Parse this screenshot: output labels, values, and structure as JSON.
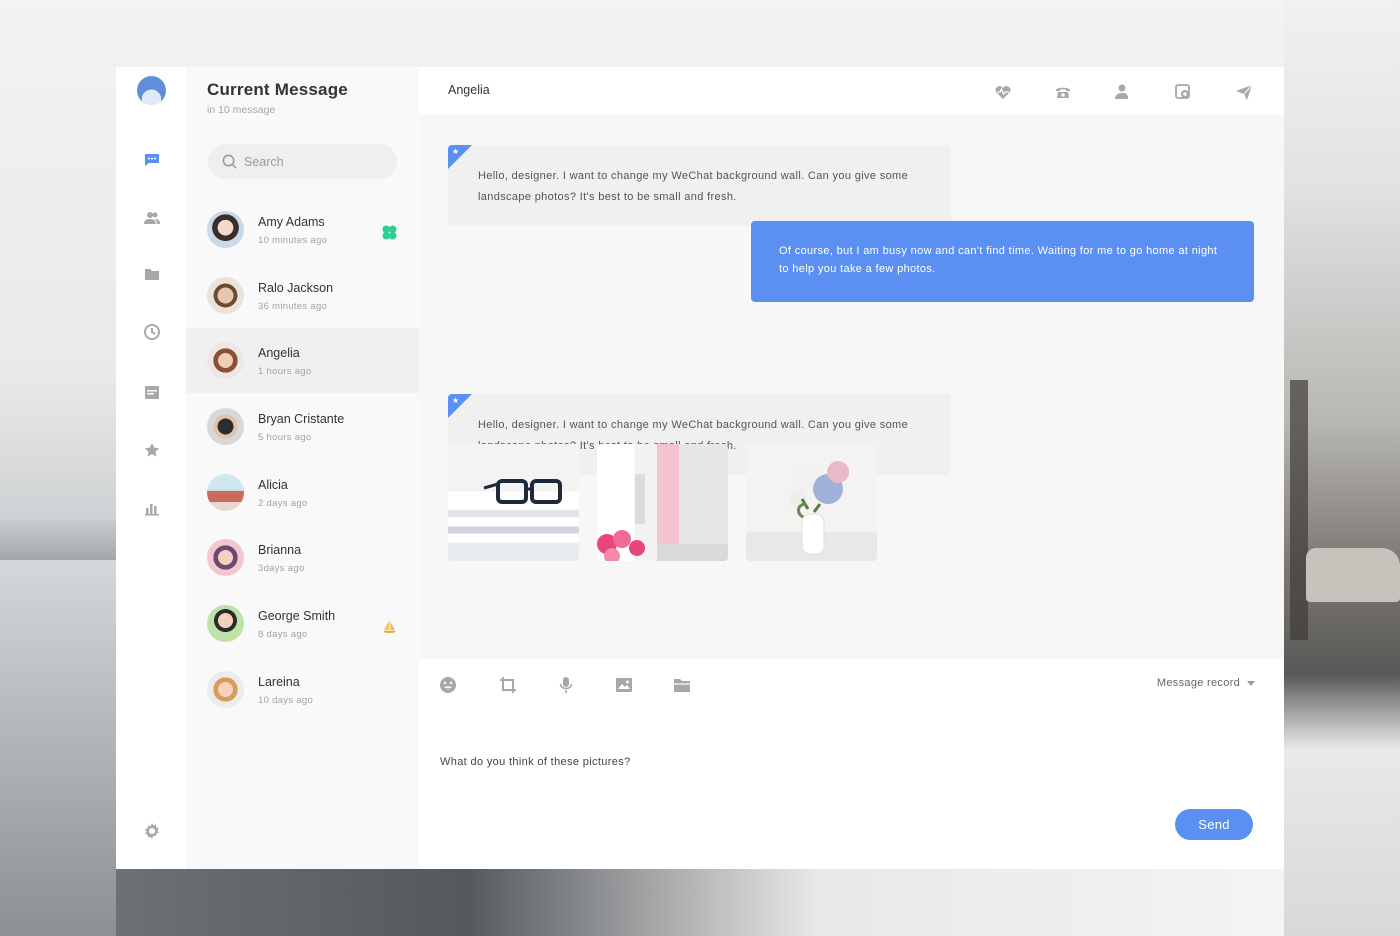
{
  "colors": {
    "accent": "#5b8ff2",
    "icon": "#a8a8a8"
  },
  "rail": {
    "items": [
      {
        "name": "messages-icon",
        "active": true
      },
      {
        "name": "contacts-icon"
      },
      {
        "name": "folder-icon"
      },
      {
        "name": "clock-icon"
      },
      {
        "name": "calendar-icon"
      },
      {
        "name": "star-icon"
      },
      {
        "name": "chart-icon"
      }
    ],
    "settings_icon": "gear-icon"
  },
  "list": {
    "title": "Current Message",
    "subtitle": "in 10 message",
    "search_placeholder": "Search",
    "contacts": [
      {
        "name": "Amy Adams",
        "time": "10 minutes ago",
        "badge": "clover-icon"
      },
      {
        "name": "Ralo Jackson",
        "time": "36 minutes ago"
      },
      {
        "name": "Angelia",
        "time": "1 hours ago",
        "active": true
      },
      {
        "name": "Bryan Cristante",
        "time": "5 hours ago"
      },
      {
        "name": "Alicia",
        "time": "2 days ago"
      },
      {
        "name": "Brianna",
        "time": "3days ago"
      },
      {
        "name": "George Smith",
        "time": "8 days ago",
        "badge": "sailboat-icon"
      },
      {
        "name": "Lareina",
        "time": "10 days ago"
      }
    ]
  },
  "chat": {
    "title": "Angelia",
    "header_icons": [
      "heartbeat-icon",
      "phone-icon",
      "add-contact-icon",
      "gallery-icon",
      "send-plane-icon"
    ],
    "messages": [
      {
        "direction": "in",
        "text": "Hello, designer. I want to change my WeChat background wall. Can you give some landscape photos? It's best to be small and fresh."
      },
      {
        "direction": "out",
        "text": "Of course, but I am busy now and can't find time. Waiting for me to go home at night to help you take a few photos."
      },
      {
        "direction": "in",
        "text": "Hello, designer. I want to change my WeChat background wall. Can you give some landscape photos? It's best to be small and fresh."
      }
    ],
    "images": [
      "glasses-on-magazines-photo",
      "pink-flowers-doorway-photo",
      "hydrangea-vase-photo"
    ]
  },
  "composer": {
    "tools": [
      "emoji-icon",
      "crop-icon",
      "microphone-icon",
      "image-icon",
      "folder-icon"
    ],
    "record_label": "Message record",
    "draft": "What do you think of these pictures?",
    "send_label": "Send"
  }
}
